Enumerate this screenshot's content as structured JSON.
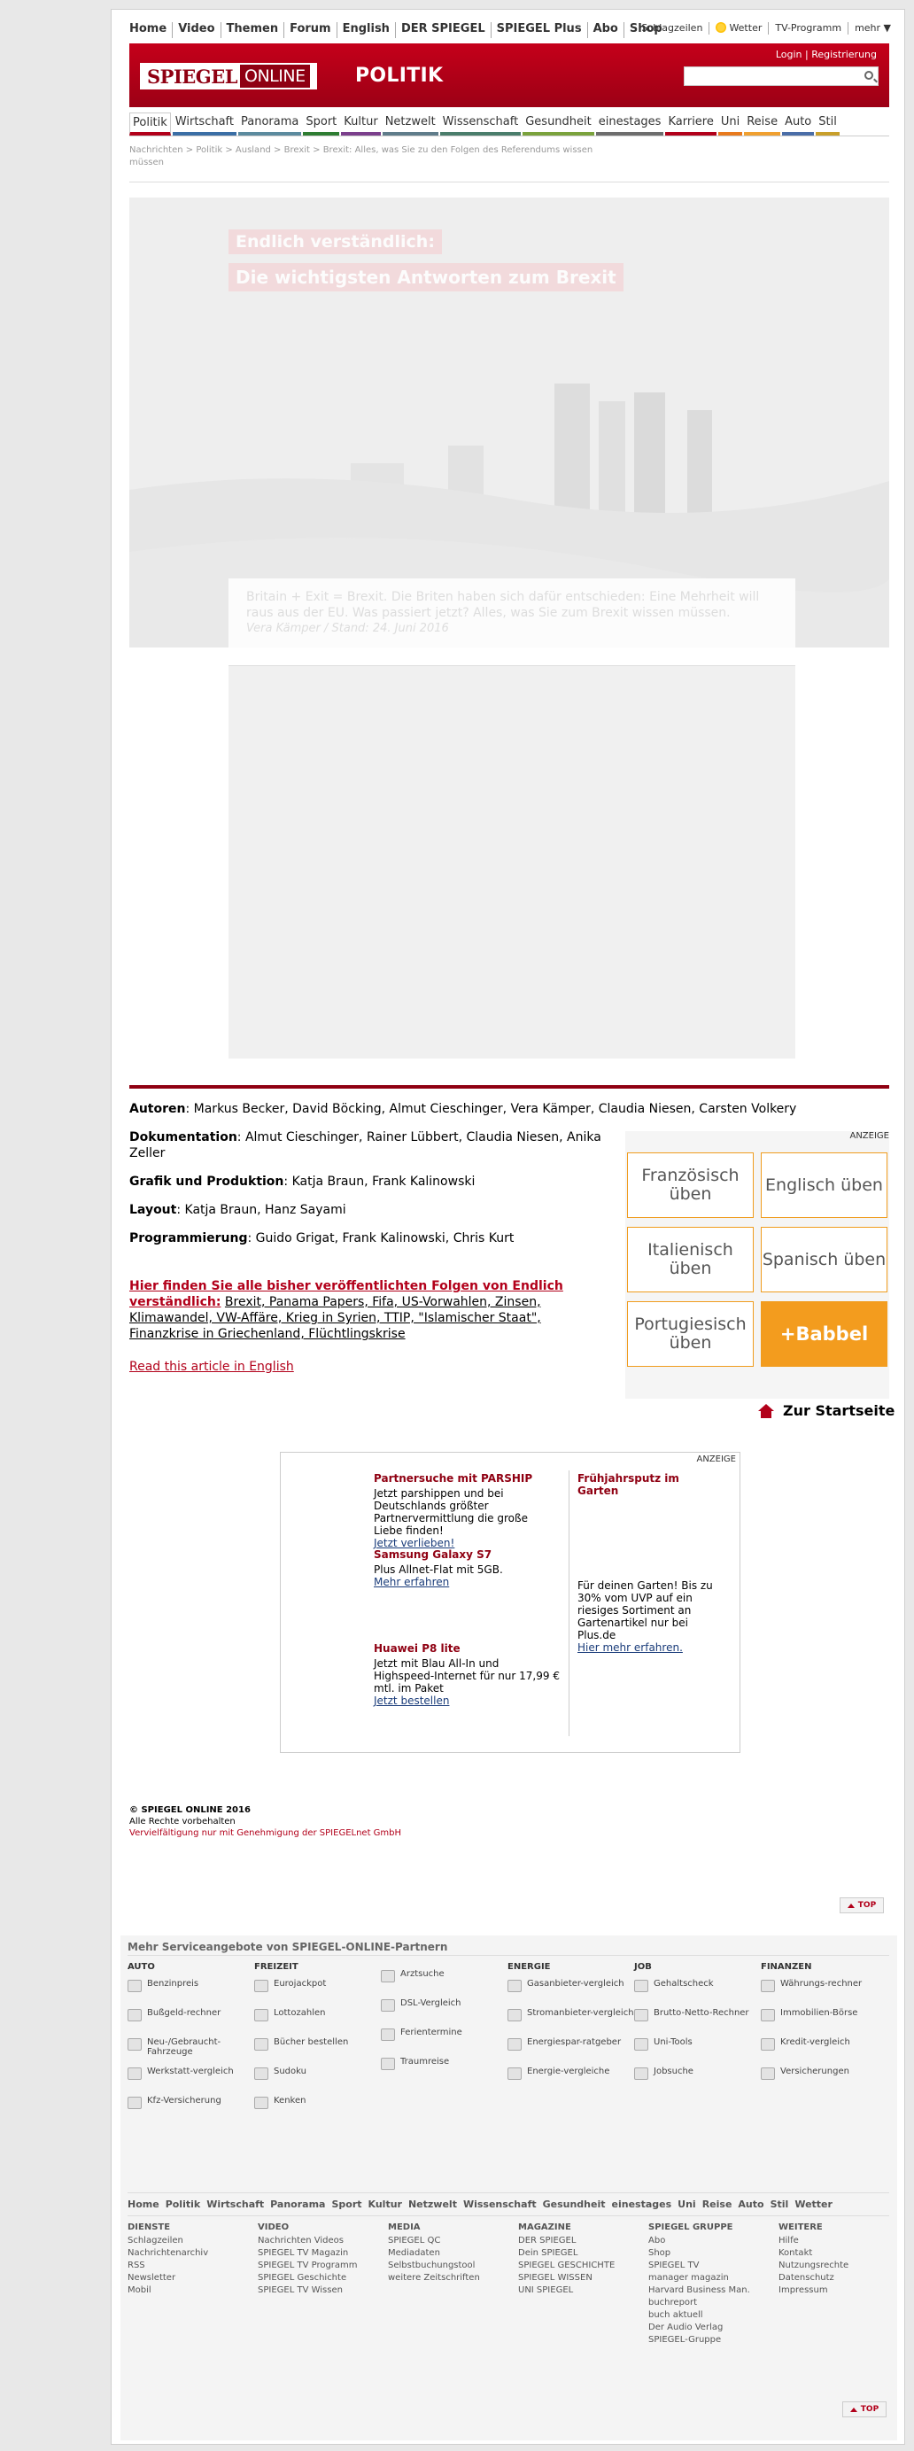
{
  "topnav": [
    "Home",
    "Video",
    "Themen",
    "Forum",
    "English",
    "DER SPIEGEL",
    "SPIEGEL Plus",
    "Abo",
    "Shop"
  ],
  "topright": {
    "schlagzeilen": "Schlagzeilen",
    "wetter": "Wetter",
    "tv": "TV-Programm",
    "mehr": "mehr ▼"
  },
  "masthead": {
    "logo_a": "SPIEGEL",
    "logo_b": "ONLINE",
    "section": "POLITIK",
    "login": "Login | Registrierung",
    "search_placeholder": ""
  },
  "secnav": [
    {
      "label": "Politik",
      "color": "#b2001a"
    },
    {
      "label": "Wirtschaft",
      "color": "#3a6ea5"
    },
    {
      "label": "Panorama",
      "color": "#5b8a9e"
    },
    {
      "label": "Sport",
      "color": "#2e7d32"
    },
    {
      "label": "Kultur",
      "color": "#7b3f8c"
    },
    {
      "label": "Netzwelt",
      "color": "#5f7c8a"
    },
    {
      "label": "Wissenschaft",
      "color": "#4a7d6b"
    },
    {
      "label": "Gesundheit",
      "color": "#7aa23c"
    },
    {
      "label": "einestages",
      "color": "#6d6d6d"
    },
    {
      "label": "Karriere",
      "color": "#b2001a"
    },
    {
      "label": "Uni",
      "color": "#e87a1e"
    },
    {
      "label": "Reise",
      "color": "#f0a030"
    },
    {
      "label": "Auto",
      "color": "#4a6da7"
    },
    {
      "label": "Stil",
      "color": "#c89f2a"
    }
  ],
  "breadcrumb": "Nachrichten > Politik > Ausland > Brexit > Brexit: Alles, was Sie zu den Folgen des Referendums wissen müssen",
  "hero": {
    "kicker": "Endlich verständlich:",
    "headline": "Die wichtigsten Antworten zum Brexit",
    "teaser": "Britain + Exit = Brexit. Die Briten haben sich dafür entschieden: Eine Mehrheit will raus aus der EU. Was passiert jetzt? Alles, was Sie zum Brexit wissen müssen.",
    "author": "Vera Kämper / Stand: 24. Juni 2016"
  },
  "credits": [
    {
      "label": "Autoren",
      "text": ": Markus Becker, David Böcking, Almut Cieschinger, Vera Kämper, Claudia Niesen, Carsten Volkery"
    },
    {
      "label": "Dokumentation",
      "text": ": Almut Cieschinger, Rainer Lübbert, Claudia Niesen, Anika Zeller"
    },
    {
      "label": "Grafik und Produktion",
      "text": ": Katja Braun, Frank Kalinowski"
    },
    {
      "label": "Layout",
      "text": ": Katja Braun, Hanz Sayami"
    },
    {
      "label": "Programmierung",
      "text": ": Guido Grigat, Frank Kalinowski, Chris Kurt"
    }
  ],
  "series": {
    "lead": "Hier finden Sie alle bisher veröffentlichten Folgen von Endlich verständlich:",
    "list": "Brexit, Panama Papers, Fifa, US-Vorwahlen, Zinsen, Klimawandel, VW-Affäre, Krieg in Syrien, TTIP, \"Islamischer Staat\", Finanzkrise in Griechenland, Flüchtlingskrise"
  },
  "english_link": "Read this article in English",
  "babbel": {
    "anzeige": "ANZEIGE",
    "buttons": [
      "Französisch üben",
      "Englisch üben",
      "Italienisch üben",
      "Spanisch üben",
      "Portugiesisch üben",
      "+Babbel"
    ]
  },
  "home_link": "Zur Startseite",
  "ads": {
    "anzeige": "ANZEIGE",
    "left": [
      {
        "title": "Partnersuche mit PARSHIP",
        "text": "Jetzt parshippen und bei Deutschlands größter Partnervermittlung die große Liebe finden!",
        "link": "Jetzt verlieben!"
      },
      {
        "title": "Samsung Galaxy S7",
        "text": "Plus Allnet-Flat mit 5GB.",
        "link": "Mehr erfahren"
      },
      {
        "title": "Huawei P8 lite",
        "text": "Jetzt mit Blau All-In und Highspeed-Internet für nur 17,99 € mtl. im Paket",
        "link": "Jetzt bestellen"
      }
    ],
    "right": {
      "title": "Frühjahrsputz im Garten",
      "text": "Für deinen Garten! Bis zu 30% vom UVP auf ein riesiges Sortiment an Gartenartikel nur bei Plus.de",
      "link": "Hier mehr erfahren."
    }
  },
  "copyright": {
    "title": "© SPIEGEL ONLINE 2016",
    "rights": "Alle Rechte vorbehalten",
    "repro": "Vervielfältigung nur mit Genehmigung der SPIEGELnet GmbH"
  },
  "top_label": "TOP",
  "service": {
    "title": "Mehr Serviceangebote von SPIEGEL-ONLINE-Partnern",
    "cols": [
      {
        "head": "AUTO",
        "items": [
          "Benzinpreis",
          "Bußgeld-rechner",
          "Neu-/Gebraucht-Fahrzeuge",
          "Werkstatt-vergleich",
          "Kfz-Versicherung"
        ]
      },
      {
        "head": "FREIZEIT",
        "items": [
          "Eurojackpot",
          "Lottozahlen",
          "Bücher bestellen",
          "Sudoku",
          "Kenken"
        ]
      },
      {
        "head": "",
        "items": [
          "Arztsuche",
          "DSL-Vergleich",
          "Ferientermine",
          "Traumreise"
        ]
      },
      {
        "head": "ENERGIE",
        "items": [
          "Gasanbieter-vergleich",
          "Stromanbieter-vergleich",
          "Energiespar-ratgeber",
          "Energie-vergleiche"
        ]
      },
      {
        "head": "JOB",
        "items": [
          "Gehaltscheck",
          "Brutto-Netto-Rechner",
          "Uni-Tools",
          "Jobsuche"
        ]
      },
      {
        "head": "FINANZEN",
        "items": [
          "Währungs-rechner",
          "Immobilien-Börse",
          "Kredit-vergleich",
          "Versicherungen"
        ]
      }
    ]
  },
  "bottomnav": [
    "Home",
    "Politik",
    "Wirtschaft",
    "Panorama",
    "Sport",
    "Kultur",
    "Netzwelt",
    "Wissenschaft",
    "Gesundheit",
    "einestages",
    "Uni",
    "Reise",
    "Auto",
    "Stil",
    "Wetter"
  ],
  "footer": [
    {
      "head": "DIENSTE",
      "items": [
        "Schlagzeilen",
        "Nachrichtenarchiv",
        "RSS",
        "Newsletter",
        "Mobil"
      ]
    },
    {
      "head": "VIDEO",
      "items": [
        "Nachrichten Videos",
        "SPIEGEL TV Magazin",
        "SPIEGEL TV Programm",
        "SPIEGEL Geschichte",
        "SPIEGEL TV Wissen"
      ]
    },
    {
      "head": "MEDIA",
      "items": [
        "SPIEGEL QC",
        "Mediadaten",
        "Selbstbuchungstool",
        "weitere Zeitschriften"
      ]
    },
    {
      "head": "MAGAZINE",
      "items": [
        "DER SPIEGEL",
        "Dein SPIEGEL",
        "SPIEGEL GESCHICHTE",
        "SPIEGEL WISSEN",
        "UNI SPIEGEL"
      ]
    },
    {
      "head": "SPIEGEL GRUPPE",
      "items": [
        "Abo",
        "Shop",
        "SPIEGEL TV",
        "manager magazin",
        "Harvard Business Man.",
        "buchreport",
        "buch aktuell",
        "Der Audio Verlag",
        "SPIEGEL-Gruppe"
      ]
    },
    {
      "head": "WEITERE",
      "items": [
        "Hilfe",
        "Kontakt",
        "Nutzungsrechte",
        "Datenschutz",
        "Impressum"
      ]
    }
  ]
}
